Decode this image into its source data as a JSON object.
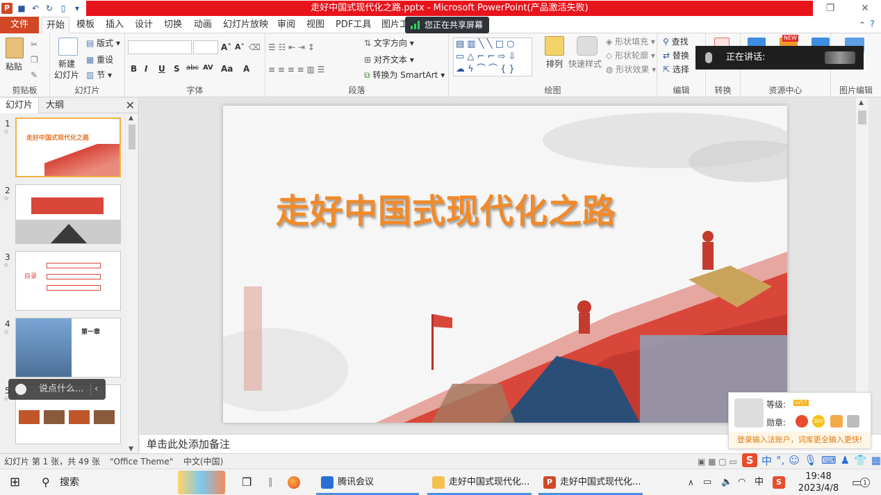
{
  "window": {
    "title": "走好中国式现代化之路.pptx - Microsoft PowerPoint(产品激活失败)"
  },
  "ribbon_tabs": {
    "file": "文件",
    "items": [
      "开始",
      "模板",
      "插入",
      "设计",
      "切换",
      "动画",
      "幻灯片放映",
      "审阅",
      "视图",
      "PDF工具",
      "图片工"
    ]
  },
  "share_toast": "您正在共享屏幕",
  "ribbon": {
    "clipboard": {
      "label": "剪贴板",
      "paste": "粘贴"
    },
    "slides": {
      "label": "幻灯片",
      "new_slide": "新建\n幻灯片",
      "layout": "版式",
      "reset": "重设",
      "section": "节"
    },
    "font": {
      "label": "字体",
      "bold": "B",
      "italic": "I",
      "underline": "U",
      "shadow": "S",
      "strike": "abc",
      "spacing": "AV",
      "case": "Aa",
      "color": "A"
    },
    "paragraph": {
      "label": "段落",
      "text_direction": "文字方向",
      "align_text": "对齐文本",
      "smartart": "转换为 SmartArt"
    },
    "drawing": {
      "label": "绘图",
      "arrange": "排列",
      "quick_styles": "快速样式",
      "shape_fill": "形状填充",
      "shape_outline": "形状轮廓",
      "shape_effects": "形状效果"
    },
    "editing": {
      "label": "编辑",
      "find": "查找",
      "replace": "替换",
      "select": "选择"
    },
    "convert": {
      "label": "转换"
    },
    "resources": {
      "label": "资源中心",
      "badge": "NEW"
    },
    "picture_edit": {
      "label": "图片编辑"
    }
  },
  "speaking": "正在讲话:",
  "left_pane": {
    "tab_slides": "幻灯片",
    "tab_outline": "大纲",
    "close": "✕",
    "thumbs": [
      {
        "num": "1",
        "title": "走好中国式现代化之路"
      },
      {
        "num": "2",
        "title": ""
      },
      {
        "num": "3",
        "title": "目录"
      },
      {
        "num": "4",
        "title": "第一章"
      },
      {
        "num": "5",
        "title": ""
      }
    ]
  },
  "chat_pill": "说点什么...",
  "slide": {
    "title": "走好中国式现代化之路"
  },
  "notes_placeholder": "单击此处添加备注",
  "status": {
    "slide_index": "幻灯片 第 1 张，共 49 张",
    "theme": "\"Office Theme\"",
    "language": "中文(中国)"
  },
  "ime": {
    "level_label": "等级:",
    "level_badge": "LV17",
    "medal_label": "勋章:",
    "medal_300": "300",
    "promo": "登录输入法账户，词库更全输入更快!"
  },
  "ime_bar": {
    "zh": "中",
    "punct": "°,"
  },
  "taskbar": {
    "search": "搜索",
    "tencent_meeting": "腾讯会议",
    "folder": "走好中国式现代化...",
    "ppt": "走好中国式现代化...",
    "ime_zh": "中",
    "time": "19:48",
    "date": "2023/4/8",
    "notify_count": "1"
  }
}
